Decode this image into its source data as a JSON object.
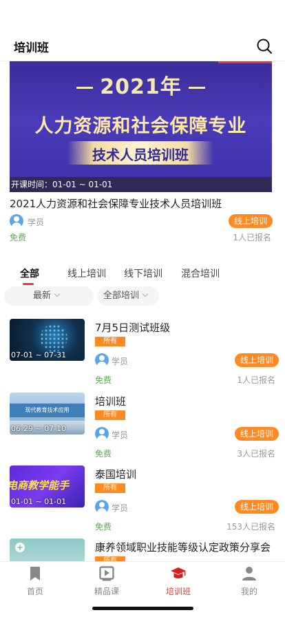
{
  "header": {
    "title": "培训班"
  },
  "featured": {
    "banner_year": "2021年",
    "banner_main": "人力资源和社会保障专业",
    "banner_sub": "技术人员培训班",
    "time_label": "开课时间：01-01 ~ 01-01",
    "title": "2021人力资源和社会保障专业技术人员培训班",
    "role": "学员",
    "tag": "线上培训",
    "price": "免费",
    "enrolled": "1人已报名"
  },
  "tabs": [
    "全部",
    "线上培训",
    "线下培训",
    "混合培训"
  ],
  "filters": {
    "sort": "最新",
    "type": "全部培训"
  },
  "courses": [
    {
      "title": "7月5日测试班级",
      "badge": "所有",
      "role": "学员",
      "tag": "线上培训",
      "price": "免费",
      "enrolled": "1人已报名",
      "date": "07-01 ~ 07-31"
    },
    {
      "title": "培训班",
      "badge": "所有",
      "role": "学员",
      "tag": "线上培训",
      "price": "免费",
      "enrolled": "3人已报名",
      "date": "06-29 ~ 07-10",
      "thumb_text": "现代教育技术应用"
    },
    {
      "title": "泰国培训",
      "badge": "所有",
      "role": "学员",
      "tag": "线上培训",
      "price": "免费",
      "enrolled": "153人已报名",
      "date": "01-01 ~ 01-01",
      "thumb_text": "电商教学能手"
    },
    {
      "title": "康养领域职业技能等级认定政策分享会",
      "badge": "所有"
    }
  ],
  "tabbar": [
    {
      "label": "首页",
      "icon": "bookmark-icon"
    },
    {
      "label": "精品课",
      "icon": "play-icon"
    },
    {
      "label": "培训班",
      "icon": "graduation-cap-icon",
      "active": true
    },
    {
      "label": "我的",
      "icon": "user-icon"
    }
  ],
  "colors": {
    "accent": "#e53935",
    "tag": "#ff8a23",
    "free": "#55b04a"
  }
}
